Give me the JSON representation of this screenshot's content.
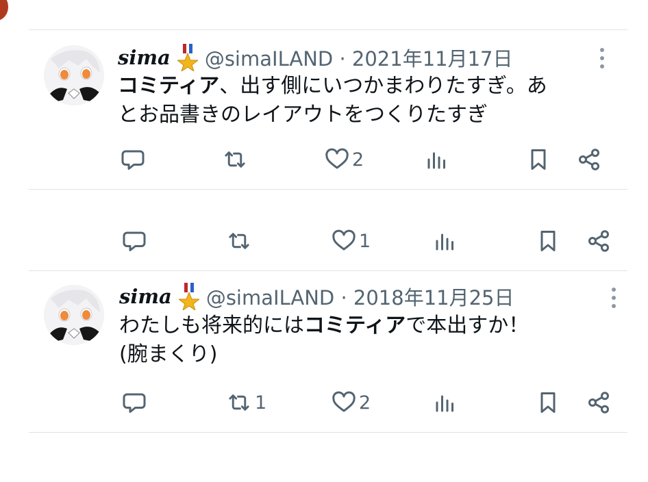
{
  "tweets": [
    {
      "name": "sima",
      "handle_date": "@simaILAND · 2021年11月17日",
      "body_prefix": "",
      "body_bold": "コミティア",
      "body_rest_line1": "、出す側にいつかまわりたすぎ。あ",
      "body_line2": "とお品書きのレイアウトをつくりたすぎ",
      "likes": "2",
      "retweets": ""
    },
    {
      "likes": "1"
    },
    {
      "name": "sima",
      "handle_date": "@simaILAND · 2018年11月25日",
      "body_prefix": "わたしも将来的には",
      "body_bold": "コミティア",
      "body_rest_line1": "で本出すか！",
      "body_line2": "(腕まくり)",
      "likes": "2",
      "retweets": "1"
    }
  ],
  "icons": {
    "reply": "reply-icon",
    "retweet": "retweet-icon",
    "like": "heart-icon",
    "views": "views-icon",
    "bookmark": "bookmark-icon",
    "share": "share-icon",
    "more": "more-icon",
    "badge": "medal-icon"
  },
  "colors": {
    "text": "#0f1419",
    "secondary": "#536471",
    "divider": "#dfe3e6"
  }
}
